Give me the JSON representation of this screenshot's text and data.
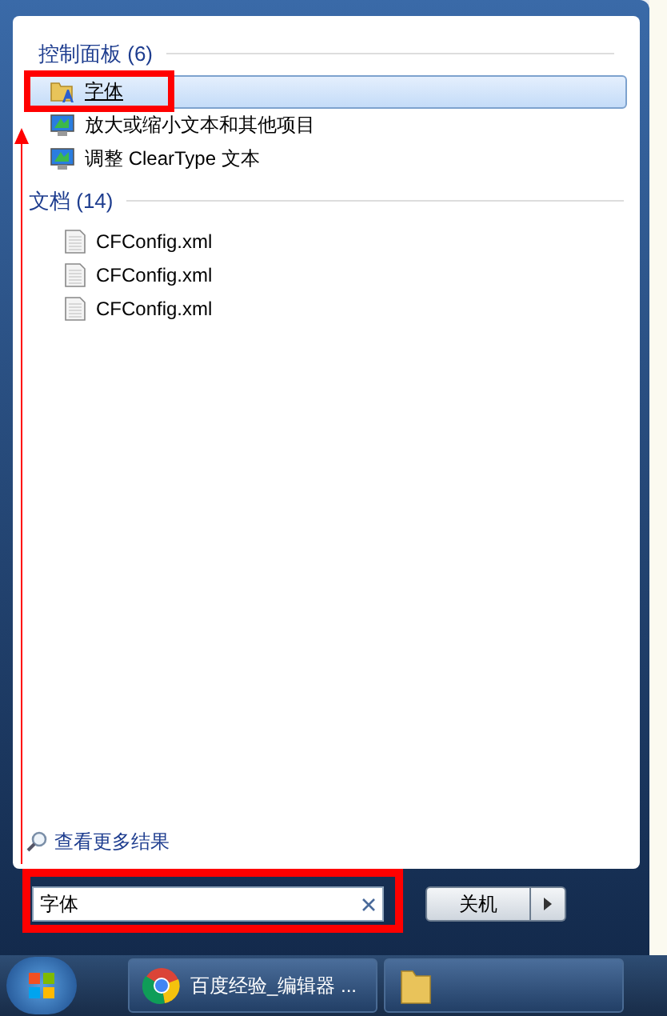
{
  "control_panel": {
    "header": "控制面板 (6)",
    "items": [
      {
        "label": "字体",
        "kind": "fonts",
        "selected": true
      },
      {
        "label": "放大或缩小文本和其他项目",
        "kind": "display",
        "selected": false
      },
      {
        "label": "调整 ClearType 文本",
        "kind": "display",
        "selected": false
      }
    ]
  },
  "documents": {
    "header": "文档 (14)",
    "items": [
      {
        "label": "CFConfig.xml"
      },
      {
        "label": "CFConfig.xml"
      },
      {
        "label": "CFConfig.xml"
      }
    ]
  },
  "see_more": "查看更多结果",
  "search": {
    "value": "字体"
  },
  "shutdown": {
    "label": "关机"
  },
  "taskbar": {
    "buttons": [
      {
        "kind": "browser",
        "label": "百度经验_编辑器 ..."
      },
      {
        "kind": "folder"
      }
    ]
  }
}
